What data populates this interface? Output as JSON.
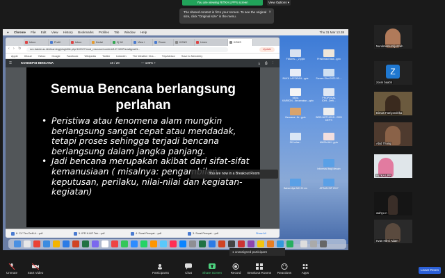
{
  "zoom": {
    "viewing_banner": "You are viewing RITKA LPP's screen",
    "view_options": "View Options ▾",
    "tooltip": "The shared content is fit to your screen. To see the original size, click \"Original size\" in the menu.",
    "breakout_tip": "You are now in a Breakout Room",
    "unassigned": "1 unassigned participant",
    "toolbar": {
      "unmute": "Unmute",
      "start_video": "Start Video",
      "participants": "Participants",
      "participants_count": "7",
      "chat": "Chat",
      "share_screen": "Share Screen",
      "record": "Record",
      "breakout_rooms": "Breakout Rooms",
      "reactions": "Reactions",
      "apps": "Apps",
      "leave": "Leave Room"
    },
    "participants": [
      {
        "name": "Nurulmarnuzirjuzzah",
        "letter": ""
      },
      {
        "name": "zoom baa04",
        "letter": "Z"
      },
      {
        "name": "Dimas Fatriyandrika",
        "letter": ""
      },
      {
        "name": "Abid Thoriq",
        "letter": ""
      },
      {
        "name": "RITKA LPP",
        "letter": ""
      },
      {
        "name": "wahyu n",
        "letter": ""
      },
      {
        "name": "Irvan Hilmi Adam",
        "letter": ""
      }
    ]
  },
  "mac": {
    "menu": [
      "Chrome",
      "File",
      "Edit",
      "View",
      "History",
      "Bookmarks",
      "Profiles",
      "Tab",
      "Window",
      "Help"
    ],
    "clock": "Thu 31 Mar 13.38"
  },
  "browser": {
    "tabs": [
      "Inbox",
      "Profil",
      "Inbox",
      "Kedai",
      "2| Wi",
      "View i",
      "Room",
      "KONS",
      "Unive",
      "KONS"
    ],
    "url": "svc.bakrie.ac.id/elearning/pluginfile.php/110027/mod_resource/content/1/2.%20Paradigma%...",
    "update_label": "Update",
    "bookmarks": [
      "Apple",
      "iCloud",
      "Yahoo",
      "Google",
      "Facebook",
      "Wikipedia",
      "Twitter",
      "LinkedIn",
      "The Weather Cha...",
      "TripAdvisor",
      "Save to Mendeley"
    ]
  },
  "pdf": {
    "title": "KONSEPSI BENCANA",
    "page": "18 / 28",
    "zoom": "100%",
    "slide_title": "Semua Bencana berlangsung perlahan",
    "bullets": [
      "Peristiwa atau fenomena alam mungkin berlangsung sangat cepat atau mendadak, tetapi proses sehingga terjadi bencana berlangsung dalam jangka panjang.",
      "Jadi bencana merupakan akibat dari sifat-sifat kemanusiaan ( misalnya: pengambilan keputusan, perilaku, nilai-nilai dan kegiatan-kegiatan)"
    ]
  },
  "downloads": {
    "items": [
      "6. CV Tim Defti A....pdf",
      "5. IPR K-MF Tah....pdf",
      "4. Surat Pernyat....pdf",
      "3. Surat Pernyat....pdf"
    ],
    "show_all": "Show All"
  },
  "desktop_files": [
    "Fixtures..._2.pptx",
    "Presentasi Mod...pptx",
    "BUKU LAPORAN...pptx",
    "Screen Shot 2022-03-...",
    "MIDA KARBON...Kecamatan...pptx",
    "PROPOSAL IDIH...Defti...",
    "Bencana...ftr...pptx",
    "BIRD METHODS...2020 DEFTI",
    "SK kelas...",
    "MASALAH...pptx",
    "Informasi bagi desain",
    "Bahan Ajar MK 20 ms",
    "JIFSAN SIP 2017"
  ],
  "colors": {
    "zoom_green": "#21a35a",
    "leave_blue": "#2b60d8",
    "avatar_blue": "#1f78d1"
  }
}
